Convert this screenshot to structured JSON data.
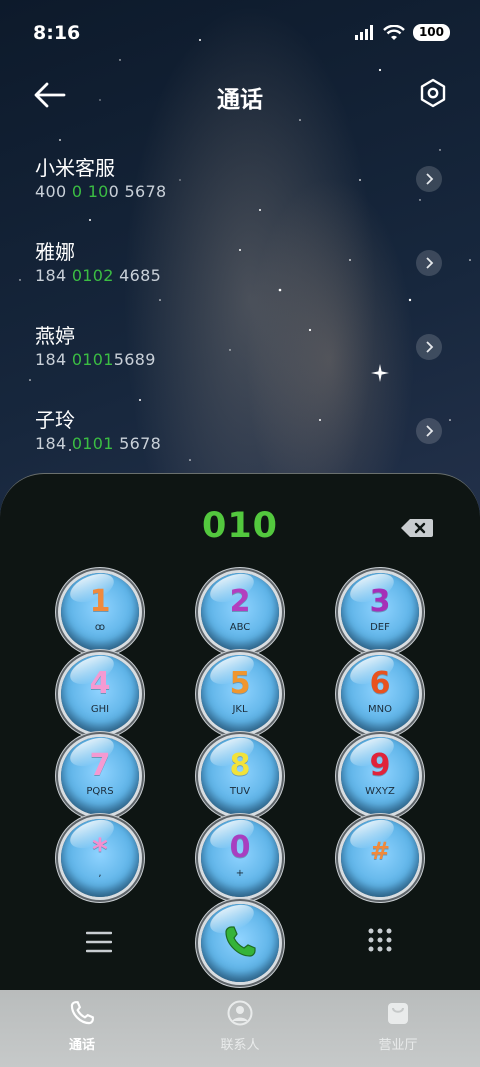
{
  "status": {
    "time": "8:16",
    "battery": "100"
  },
  "header": {
    "title": "通话"
  },
  "contacts": [
    {
      "name": "小米客服",
      "number": {
        "pre": "400 ",
        "match": "0 10",
        "post": "0 5678"
      }
    },
    {
      "name": "雅娜",
      "number": {
        "pre": "184 ",
        "match": "0102",
        "post": " 4685"
      }
    },
    {
      "name": "燕婷",
      "number": {
        "pre": "184 ",
        "match": "0101",
        "post": "5689"
      }
    },
    {
      "name": "子玲",
      "number": {
        "pre": "184 ",
        "match": "0101",
        "post": " 5678"
      }
    }
  ],
  "dialer": {
    "input": "010",
    "keys": [
      {
        "digit": "1",
        "sub": "ꝏ",
        "color": "#f08a3c"
      },
      {
        "digit": "2",
        "sub": "ABC",
        "color": "#b23fbf"
      },
      {
        "digit": "3",
        "sub": "DEF",
        "color": "#a52fb8"
      },
      {
        "digit": "4",
        "sub": "GHI",
        "color": "#f49ad2"
      },
      {
        "digit": "5",
        "sub": "JKL",
        "color": "#f0962e"
      },
      {
        "digit": "6",
        "sub": "MNO",
        "color": "#e8521f"
      },
      {
        "digit": "7",
        "sub": "PQRS",
        "color": "#f49ad2"
      },
      {
        "digit": "8",
        "sub": "TUV",
        "color": "#f2e23a"
      },
      {
        "digit": "9",
        "sub": "WXYZ",
        "color": "#e0233a"
      },
      {
        "digit": "*",
        "sub": ",",
        "color": "#f48fd0"
      },
      {
        "digit": "0",
        "sub": "+",
        "color": "#a83fc0"
      },
      {
        "digit": "#",
        "sub": "",
        "color": "#f08a3c"
      }
    ]
  },
  "nav": {
    "items": [
      {
        "label": "通话",
        "active": true
      },
      {
        "label": "联系人",
        "active": false
      },
      {
        "label": "营业厅",
        "active": false
      }
    ]
  },
  "colors": {
    "accent_green": "#53c83e",
    "highlight_green": "#3bbd43"
  }
}
